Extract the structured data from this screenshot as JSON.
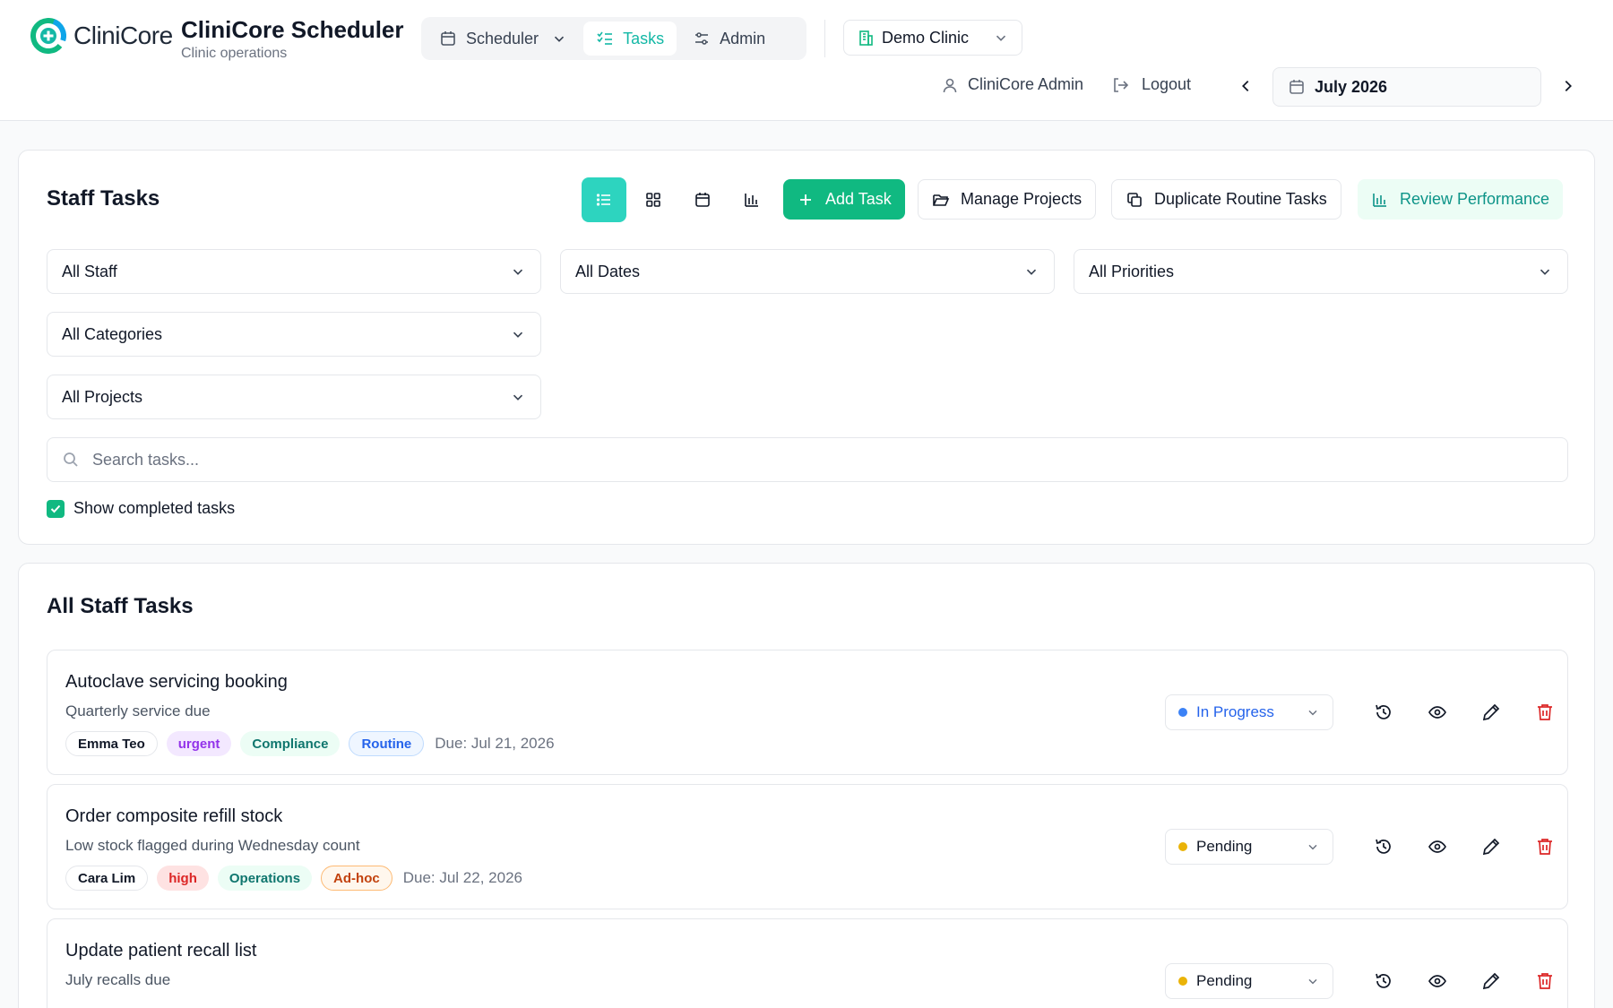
{
  "header": {
    "logo_text": "CliniCore",
    "app_title": "CliniCore Scheduler",
    "app_subtitle": "Clinic operations",
    "nav": [
      {
        "label": "Scheduler",
        "icon": "calendar-icon"
      },
      {
        "label": "Tasks",
        "icon": "checklist-icon"
      },
      {
        "label": "Admin",
        "icon": "sliders-icon"
      }
    ],
    "clinic": "Demo Clinic",
    "user": "CliniCore Admin",
    "logout": "Logout",
    "month": "July 2026"
  },
  "colors": {
    "accent": "#14b8a6",
    "primary": "#10b981"
  },
  "toolbar": {
    "title": "Staff Tasks",
    "views": [
      "list-view",
      "grid-view",
      "calendar-view",
      "chart-view"
    ],
    "add_task": "Add Task",
    "manage_projects": "Manage Projects",
    "duplicate": "Duplicate Routine Tasks",
    "review": "Review Performance"
  },
  "filters": {
    "staff": "All Staff",
    "dates": "All Dates",
    "priorities": "All Priorities",
    "categories": "All Categories",
    "projects": "All Projects",
    "search_placeholder": "Search tasks...",
    "show_completed": "Show completed tasks",
    "show_completed_checked": true
  },
  "task_list": {
    "title": "All Staff Tasks",
    "tasks": [
      {
        "title": "Autoclave servicing booking",
        "description": "Quarterly service due",
        "staff": "Emma Teo",
        "priority": "urgent",
        "category": "Compliance",
        "type": "Routine",
        "due": "Due: Jul 21, 2026",
        "status": "In Progress",
        "status_color": "#3b82f6"
      },
      {
        "title": "Order composite refill stock",
        "description": "Low stock flagged during Wednesday count",
        "staff": "Cara Lim",
        "priority": "high",
        "category": "Operations",
        "type": "Ad-hoc",
        "due": "Due: Jul 22, 2026",
        "status": "Pending",
        "status_color": "#eab308"
      },
      {
        "title": "Update patient recall list",
        "description": "July recalls due",
        "status": "Pending",
        "status_color": "#eab308"
      }
    ]
  }
}
